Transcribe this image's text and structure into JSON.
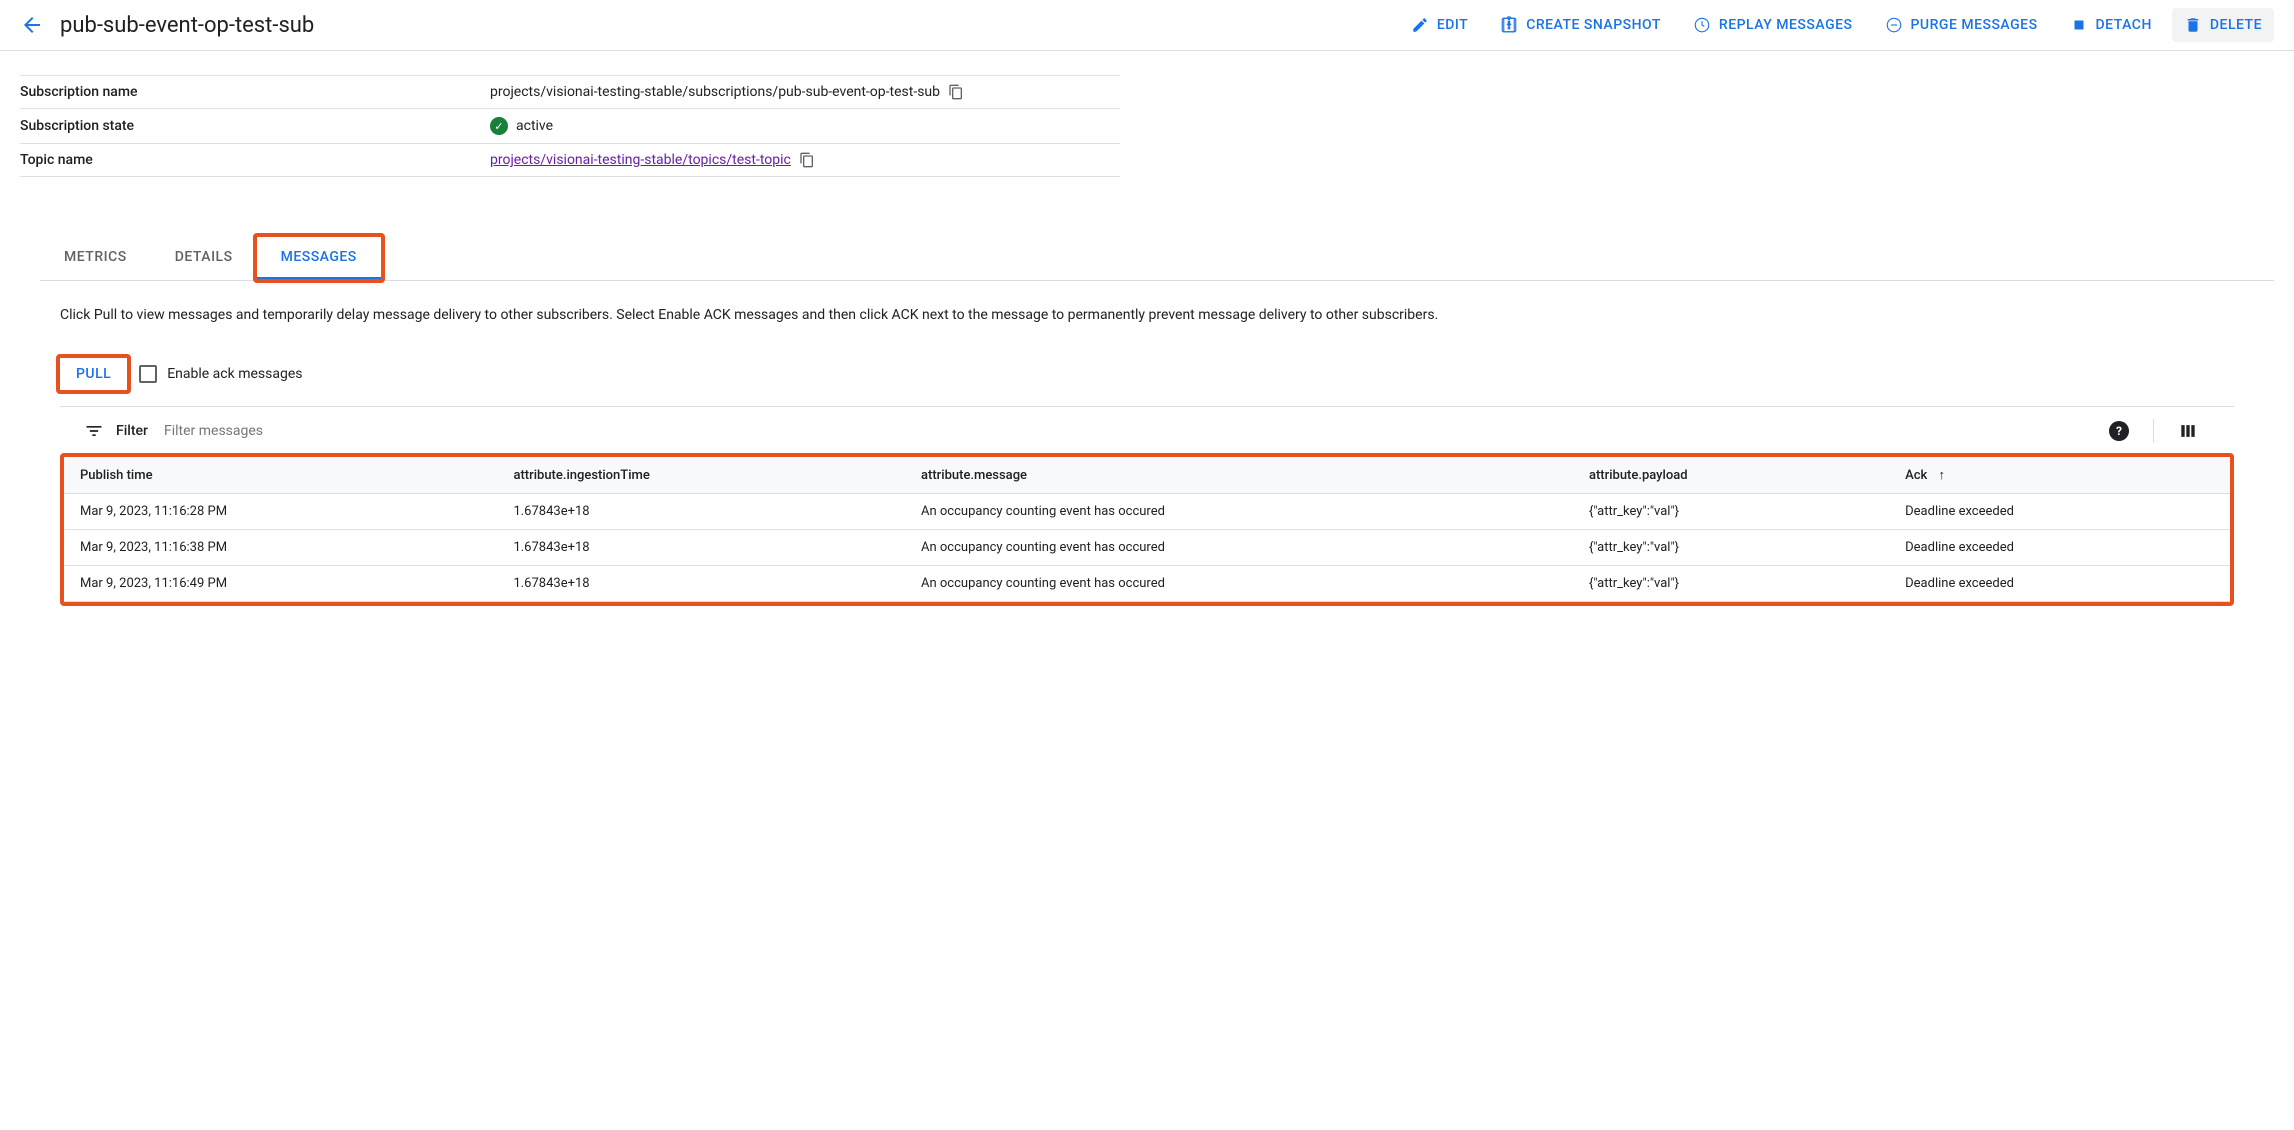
{
  "header": {
    "title": "pub-sub-event-op-test-sub",
    "actions": {
      "edit": "EDIT",
      "create_snapshot": "CREATE SNAPSHOT",
      "replay_messages": "REPLAY MESSAGES",
      "purge_messages": "PURGE MESSAGES",
      "detach": "DETACH",
      "delete": "DELETE"
    }
  },
  "details": {
    "subscription_name_label": "Subscription name",
    "subscription_name_value": "projects/visionai-testing-stable/subscriptions/pub-sub-event-op-test-sub",
    "subscription_state_label": "Subscription state",
    "subscription_state_value": "active",
    "topic_name_label": "Topic name",
    "topic_name_value": "projects/visionai-testing-stable/topics/test-topic"
  },
  "tabs": {
    "metrics": "METRICS",
    "details": "DETAILS",
    "messages": "MESSAGES"
  },
  "messages": {
    "help_text": "Click Pull to view messages and temporarily delay message delivery to other subscribers. Select Enable ACK messages and then click ACK next to the message to permanently prevent message delivery to other subscribers.",
    "pull_button": "PULL",
    "enable_ack_label": "Enable ack messages",
    "filter_label": "Filter",
    "filter_placeholder": "Filter messages"
  },
  "table": {
    "headers": {
      "publish_time": "Publish time",
      "ingestion_time": "attribute.ingestionTime",
      "message": "attribute.message",
      "payload": "attribute.payload",
      "ack": "Ack"
    },
    "rows": [
      {
        "publish_time": "Mar 9, 2023, 11:16:28 PM",
        "ingestion_time": "1.67843e+18",
        "message": "An occupancy counting event has occured",
        "payload": "{\"attr_key\":\"val\"}",
        "ack": "Deadline exceeded"
      },
      {
        "publish_time": "Mar 9, 2023, 11:16:38 PM",
        "ingestion_time": "1.67843e+18",
        "message": "An occupancy counting event has occured",
        "payload": "{\"attr_key\":\"val\"}",
        "ack": "Deadline exceeded"
      },
      {
        "publish_time": "Mar 9, 2023, 11:16:49 PM",
        "ingestion_time": "1.67843e+18",
        "message": "An occupancy counting event has occured",
        "payload": "{\"attr_key\":\"val\"}",
        "ack": "Deadline exceeded"
      }
    ]
  }
}
